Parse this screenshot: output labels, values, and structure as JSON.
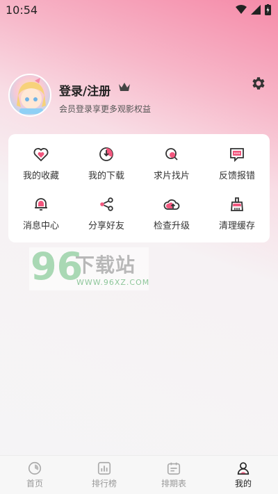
{
  "status_bar": {
    "time": "10:54"
  },
  "profile": {
    "login_label": "登录/注册",
    "subtitle": "会员登录享更多观影权益"
  },
  "menu": {
    "items": [
      {
        "label": "我的收藏",
        "icon": "heart-icon"
      },
      {
        "label": "我的下载",
        "icon": "download-icon"
      },
      {
        "label": "求片找片",
        "icon": "search-film-icon"
      },
      {
        "label": "反馈报错",
        "icon": "feedback-icon"
      },
      {
        "label": "消息中心",
        "icon": "bell-icon"
      },
      {
        "label": "分享好友",
        "icon": "share-icon"
      },
      {
        "label": "检查升级",
        "icon": "upload-cloud-icon"
      },
      {
        "label": "清理缓存",
        "icon": "broom-icon"
      }
    ]
  },
  "watermark": {
    "big": "96",
    "cn": "下载站",
    "url": "WWW.96XZ.COM"
  },
  "tabbar": {
    "items": [
      {
        "label": "首页",
        "icon": "home-icon"
      },
      {
        "label": "排行榜",
        "icon": "chart-icon"
      },
      {
        "label": "排期表",
        "icon": "calendar-icon"
      },
      {
        "label": "我的",
        "icon": "user-icon"
      }
    ]
  },
  "colors": {
    "accent": "#f2577e",
    "icon_dark": "#333333"
  }
}
